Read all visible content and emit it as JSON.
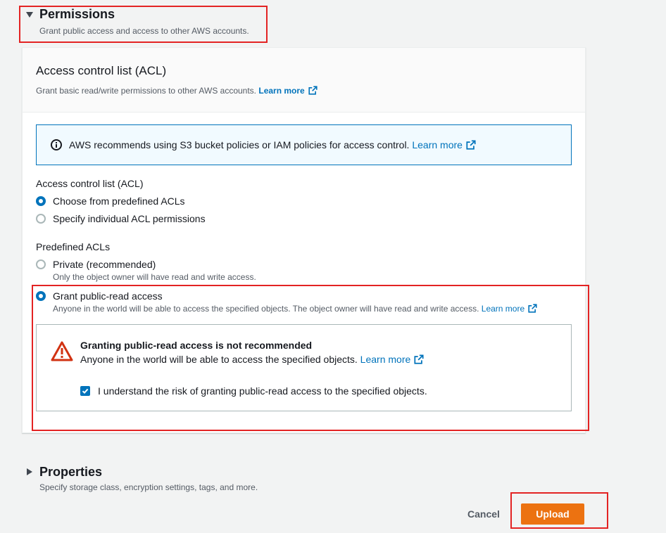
{
  "permissions": {
    "title": "Permissions",
    "subtitle": "Grant public access and access to other AWS accounts.",
    "expanded": true
  },
  "acl_panel": {
    "title": "Access control list (ACL)",
    "description": "Grant basic read/write permissions to other AWS accounts.",
    "learn_more": "Learn more",
    "info": {
      "text": "AWS recommends using S3 bucket policies or IAM policies for access control.",
      "learn_more": "Learn more"
    },
    "acl_mode": {
      "label": "Access control list (ACL)",
      "options": [
        {
          "label": "Choose from predefined ACLs",
          "selected": true
        },
        {
          "label": "Specify individual ACL permissions",
          "selected": false
        }
      ]
    },
    "predefined_acls": {
      "label": "Predefined ACLs",
      "options": [
        {
          "label": "Private (recommended)",
          "description": "Only the object owner will have read and write access.",
          "selected": false
        },
        {
          "label": "Grant public-read access",
          "description": "Anyone in the world will be able to access the specified objects. The object owner will have read and write access.",
          "learn_more": "Learn more",
          "selected": true
        }
      ]
    },
    "warning": {
      "title": "Granting public-read access is not recommended",
      "text": "Anyone in the world will be able to access the specified objects.",
      "learn_more": "Learn more",
      "acknowledge": {
        "label": "I understand the risk of granting public-read access to the specified objects.",
        "checked": true
      }
    }
  },
  "properties": {
    "title": "Properties",
    "subtitle": "Specify storage class, encryption settings, tags, and more.",
    "expanded": false
  },
  "actions": {
    "cancel": "Cancel",
    "upload": "Upload"
  },
  "icons": {
    "permissions_toggle": "caret-down-icon",
    "properties_toggle": "caret-right-icon",
    "info": "info-icon",
    "warning": "warning-icon",
    "external_link": "external-link-icon",
    "checkbox_check": "checkmark-icon"
  },
  "colors": {
    "link": "#0073bb",
    "primary": "#ec7211",
    "warn": "#d13212",
    "annot": "#e32323",
    "bg": "#f2f3f3"
  }
}
